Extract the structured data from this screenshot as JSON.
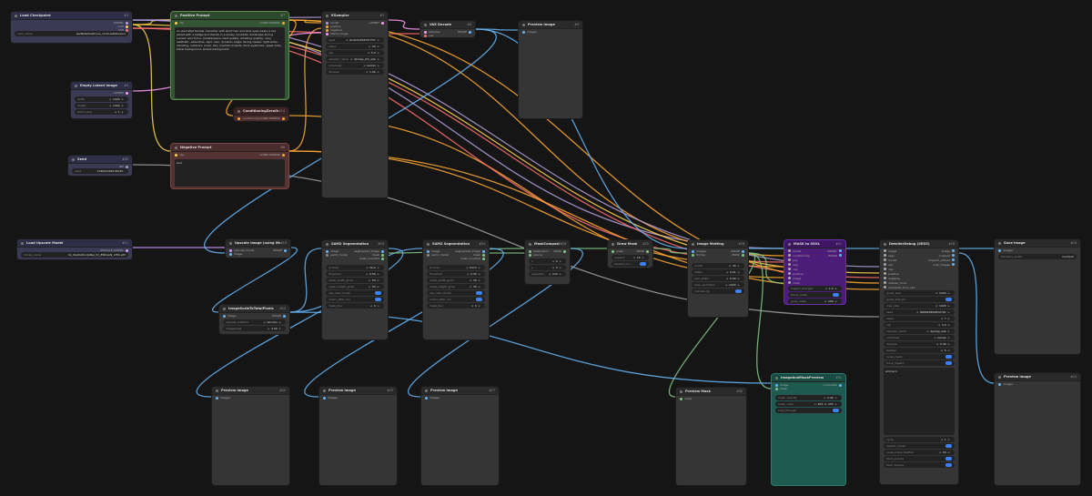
{
  "colors": {
    "model": "#b39ddb",
    "clip": "#ffd54f",
    "vae": "#ff6e6e",
    "latent": "#ff9cf9",
    "image": "#64b5f6",
    "mask": "#81c784",
    "cond": "#ffa931",
    "int": "#a0a0a0",
    "upscale": "#d0a0ff"
  },
  "nodes": {
    "load_checkpoint": {
      "title": "Load Checkpoint",
      "id": "#4",
      "ports": [
        "MODEL",
        "CLIP",
        "VAE"
      ],
      "w_ckpt_label": "ckpt_name",
      "w_ckpt": "waiNsfwIllustrious_v140.safetensors"
    },
    "positive_prompt": {
      "title": "Positive Prompt",
      "id": "#7",
      "port_in": "clip",
      "port_out": "CONDITIONING",
      "text": "an animated female character with short hair and blue eyes wears a red jacket with a badge and stands in a snowy mountain landscape during sunset, solo focus, (masterpiece, best quality, amazing quality), very aesthetic, absurdres, 1girl, solo, dynamic angle, facing viewer, light smile, standing, outdoors, snow, city, medium breasts, thick eyebrows, upper body, blank background, simple background"
    },
    "ksampler": {
      "title": "KSampler",
      "id": "#3",
      "inputs": [
        "model",
        "positive",
        "negative",
        "latent_image"
      ],
      "output": "LATENT",
      "widgets": [
        [
          "seed",
          "614231258747757"
        ],
        [
          "steps",
          "20"
        ],
        [
          "cfg",
          "5.0"
        ],
        [
          "sampler_name",
          "dpmpp_2m_sde"
        ],
        [
          "scheduler",
          "karras"
        ],
        [
          "denoise",
          "1.00"
        ]
      ]
    },
    "vae_decode": {
      "title": "VAE Decode",
      "id": "#8",
      "inputs": [
        "samples",
        "vae"
      ],
      "output": "IMAGE"
    },
    "preview_top": {
      "title": "Preview Image",
      "id": "#9",
      "input": "images"
    },
    "empty_latent": {
      "title": "Empty Latent Image",
      "id": "#5",
      "output": "LATENT",
      "widgets": [
        [
          "width",
          "1024"
        ],
        [
          "height",
          "1024"
        ],
        [
          "batch_size",
          "1"
        ]
      ]
    },
    "cond_zero": {
      "title": "ConditioningZeroOut",
      "id": "#14",
      "input": "conditioning",
      "output": "CONDITIONING"
    },
    "seed": {
      "title": "Seed",
      "id": "#45",
      "output": "INT",
      "w_label": "seed",
      "w_val": "218922286136225..."
    },
    "negative_prompt": {
      "title": "Negative Prompt",
      "id": "#6",
      "port_in": "clip",
      "port_out": "CONDITIONING",
      "text": "bad"
    },
    "load_upscale": {
      "title": "Load Upscale Model",
      "id": "#11",
      "output": "UPSCALE_MODEL",
      "w_label": "model_name",
      "w_val": "4x_IllustrationJaNai_V1_ESRGAN_135k.pth"
    },
    "upscale_image": {
      "title": "Upscale Image (using Model)",
      "id": "#13",
      "inputs": [
        "upscale_model",
        "image"
      ],
      "output": "IMAGE"
    },
    "img_scale": {
      "title": "ImageScaleToTotalPixels",
      "id": "#12",
      "input": "image",
      "output": "IMAGE",
      "widgets": [
        [
          "upscale_method",
          "lanczos"
        ],
        [
          "megapixels",
          "4.00"
        ]
      ]
    },
    "sam1": {
      "title": "SAM2 Segmentation",
      "id": "#15",
      "inputs": [
        "image",
        "sam2_model"
      ],
      "outputs": [
        "segmented_image",
        "mask",
        "mask_inverted"
      ],
      "widgets": [
        [
          "prompt",
          "face"
        ],
        [
          "threshold",
          "0.50"
        ],
        [
          "mask_width_grow",
          "50"
        ],
        [
          "mask_height_grow",
          "50"
        ],
        [
          "use_ratio_mode",
          ""
        ],
        [
          "invert_after_run",
          ""
        ],
        [
          "mask_blur",
          "0"
        ]
      ]
    },
    "sam2": {
      "title": "SAM2 Segmentation",
      "id": "#24",
      "inputs": [
        "image",
        "sam2_model"
      ],
      "outputs": [
        "segmented_image",
        "mask",
        "mask_inverted"
      ],
      "widgets": [
        [
          "prompt",
          "hand"
        ],
        [
          "threshold",
          "0.30"
        ],
        [
          "mask_width_grow",
          "30"
        ],
        [
          "mask_height_grow",
          "30"
        ],
        [
          "use_ratio_mode",
          ""
        ],
        [
          "invert_after_run",
          ""
        ],
        [
          "mask_blur",
          "0"
        ]
      ]
    },
    "mask_comp": {
      "title": "MaskComposite",
      "id": "#26",
      "inputs": [
        "destination",
        "source"
      ],
      "output": "MASK",
      "widgets": [
        [
          "x",
          "0"
        ],
        [
          "y",
          "0"
        ],
        [
          "operation",
          "add"
        ]
      ]
    },
    "grow_mask": {
      "title": "Grow Mask",
      "id": "#22",
      "input": "mask",
      "output": "MASK",
      "widgets": [
        [
          "expand",
          "10"
        ],
        [
          "tapered_co...",
          ""
        ]
      ]
    },
    "image_matting": {
      "title": "Image Matting",
      "id": "#16",
      "inputs": [
        "images",
        "trimap"
      ],
      "outputs": [
        "IMAGE",
        "MASK"
      ],
      "widgets": [
        [
          "erode",
          "30"
        ],
        [
          "dilate",
          "0.01"
        ],
        [
          "sam_steps",
          "0.99"
        ],
        [
          "max_resolution",
          "1024"
        ],
        [
          "indicate_fg",
          ""
        ]
      ]
    },
    "mask_sdxl": {
      "title": "MASK to SDXL",
      "id": "#21",
      "inputs": [
        "model",
        "conditioning",
        "pos",
        "neg",
        "vae",
        "positive",
        "image",
        "mask"
      ],
      "outputs": [
        "MODEL",
        "IMAGE"
      ],
      "widgets": [
        [
          "inpaint_strength",
          "1.0"
        ],
        [
          "blend_mask",
          ""
        ],
        [
          "grow_mask",
          "100"
        ],
        [
          "preserve_size",
          ""
        ]
      ]
    },
    "detailer": {
      "title": "DetailerDebug (SEGS)",
      "id": "#18",
      "inputs": [
        "image",
        "segs",
        "model",
        "clip",
        "vae",
        "positive",
        "negative",
        "detailer_hook",
        "scheduler_func_opt"
      ],
      "outputs": [
        "image",
        "cropped",
        "cropped_refined",
        "cnet_images"
      ],
      "widgets": [
        [
          "guide_size",
          "1024"
        ],
        [
          "guide_size_for",
          ""
        ],
        [
          "max_size",
          "1024"
        ],
        [
          "seed",
          "880695656820791"
        ],
        [
          "steps",
          "7"
        ],
        [
          "cfg",
          "3.0"
        ],
        [
          "sampler_name",
          "dpmpp_sde"
        ],
        [
          "scheduler",
          "karras"
        ],
        [
          "denoise",
          "0.40"
        ],
        [
          "feather",
          "5"
        ],
        [
          "noise_mask",
          ""
        ],
        [
          "force_inpaint",
          ""
        ]
      ],
      "text": "wildcard",
      "widgets2": [
        [
          "cycle",
          "1"
        ],
        [
          "inpaint_model",
          ""
        ],
        [
          "noise_mask_feather",
          "20"
        ],
        [
          "tiled_encode",
          ""
        ],
        [
          "tiled_decode",
          ""
        ]
      ]
    },
    "save_image": {
      "title": "Save Image",
      "id": "#19",
      "input": "images",
      "w_label": "filename_prefix",
      "w_val": "ComfyUI"
    },
    "preview_b1": {
      "title": "Preview Image",
      "id": "#20",
      "input": "images"
    },
    "preview_b2": {
      "title": "Preview Image",
      "id": "#25",
      "input": "images"
    },
    "preview_b3": {
      "title": "Preview Image",
      "id": "#27",
      "input": "images"
    },
    "preview_mask": {
      "title": "Preview Mask",
      "id": "#30",
      "input": "mask"
    },
    "img_mask_preview": {
      "title": "ImageAndMaskPreview",
      "id": "#31",
      "inputs": [
        "image",
        "mask"
      ],
      "output": "composite",
      "widgets": [
        [
          "mask_opacity",
          "0.40"
        ],
        [
          "mask_color",
          "255, 0, 255"
        ],
        [
          "pass_through",
          ""
        ]
      ]
    },
    "preview_right": {
      "title": "Preview Image",
      "id": "#10",
      "input": "images"
    }
  }
}
